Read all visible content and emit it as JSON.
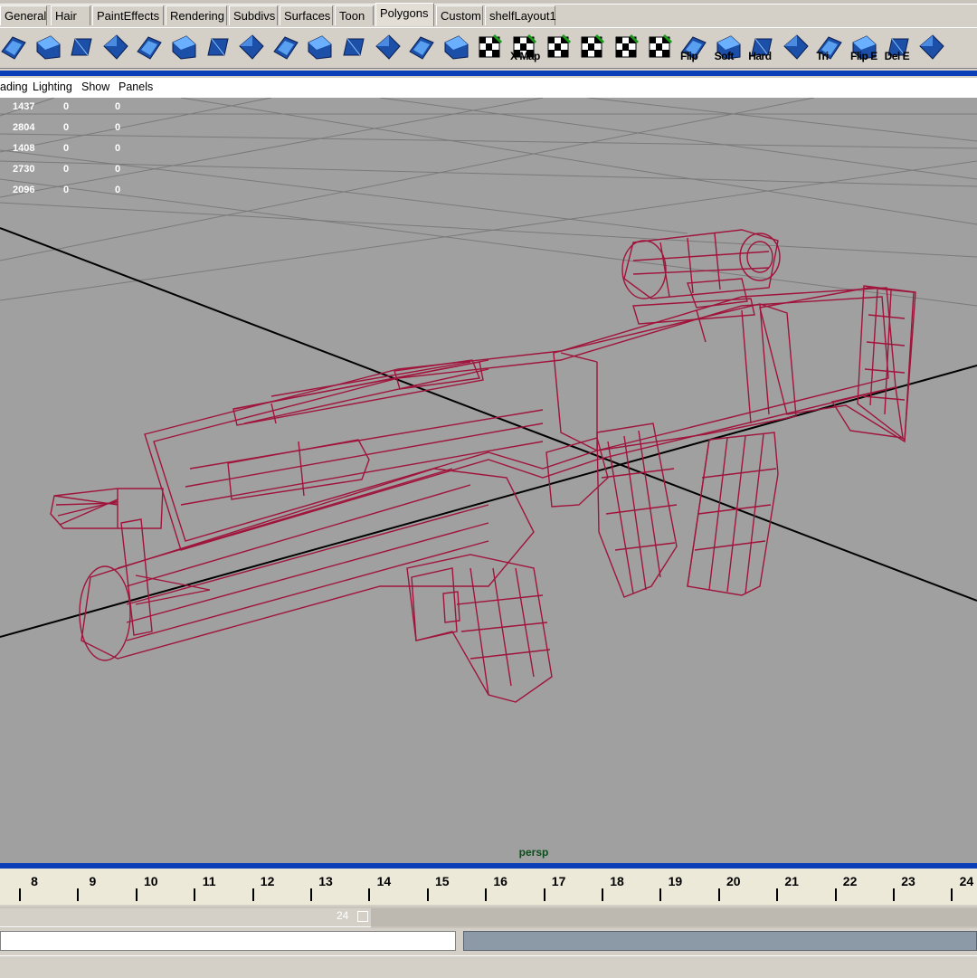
{
  "shelf_tabs": [
    "General",
    "Hair",
    "PaintEffects",
    "Rendering",
    "Subdivs",
    "Surfaces",
    "Toon",
    "Polygons",
    "Custom",
    "shelfLayout1"
  ],
  "active_tab": "Polygons",
  "shelf_buttons": [
    {
      "icon": "sphere-icon",
      "label": ""
    },
    {
      "icon": "poly-plane-icon",
      "label": ""
    },
    {
      "icon": "poly-select-icon",
      "label": ""
    },
    {
      "icon": "poly-cube-icon",
      "label": ""
    },
    {
      "icon": "poly-extrude-icon",
      "label": ""
    },
    {
      "icon": "poly-split-icon",
      "label": ""
    },
    {
      "icon": "poly-bevel-icon",
      "label": ""
    },
    {
      "icon": "poly-append-icon",
      "label": ""
    },
    {
      "icon": "poly-merge-icon",
      "label": ""
    },
    {
      "icon": "poly-wedge-icon",
      "label": ""
    },
    {
      "icon": "poly-smooth-icon",
      "label": ""
    },
    {
      "icon": "poly-subdivide-icon",
      "label": ""
    },
    {
      "icon": "poly-combine-icon",
      "label": ""
    },
    {
      "icon": "poly-move-icon",
      "label": ""
    },
    {
      "icon": "uv-checker-icon",
      "label": ""
    },
    {
      "icon": "uv-map-icon",
      "label": "X Map"
    },
    {
      "icon": "uv-layout-icon",
      "label": ""
    },
    {
      "icon": "uv-rotate-icon",
      "label": ""
    },
    {
      "icon": "uv-normalize-icon",
      "label": ""
    },
    {
      "icon": "uv-editor-icon",
      "label": ""
    },
    {
      "icon": "normal-flip-icon",
      "label": "Flip"
    },
    {
      "icon": "soften-edge-icon",
      "label": "Soft"
    },
    {
      "icon": "harden-edge-icon",
      "label": "Hard"
    },
    {
      "icon": "triangulate-icon",
      "label": ""
    },
    {
      "icon": "quadrangulate-icon",
      "label": "Tri"
    },
    {
      "icon": "flip-edge-icon",
      "label": "Flip E"
    },
    {
      "icon": "delete-edge-icon",
      "label": "Del E"
    },
    {
      "icon": "poly-cleanup-icon",
      "label": ""
    }
  ],
  "panel_menu": [
    "ading",
    "Lighting",
    "Show",
    "Panels"
  ],
  "hud_stats": [
    [
      "1437",
      "0",
      "0"
    ],
    [
      "2804",
      "0",
      "0"
    ],
    [
      "1408",
      "0",
      "0"
    ],
    [
      "2730",
      "0",
      "0"
    ],
    [
      "2096",
      "0",
      "0"
    ]
  ],
  "camera_label": "persp",
  "timeline_ticks": [
    "8",
    "9",
    "10",
    "11",
    "12",
    "13",
    "14",
    "15",
    "16",
    "17",
    "18",
    "19",
    "20",
    "21",
    "22",
    "23",
    "24"
  ],
  "range_end": "24",
  "colors": {
    "viewport_bg": "#a0a0a0",
    "wireframe": "#a0143c",
    "grid": "#7a7a7a",
    "axis": "#000000",
    "shelf_icon": "#1b4fa8",
    "highlight_bar": "#0a3fb8"
  }
}
